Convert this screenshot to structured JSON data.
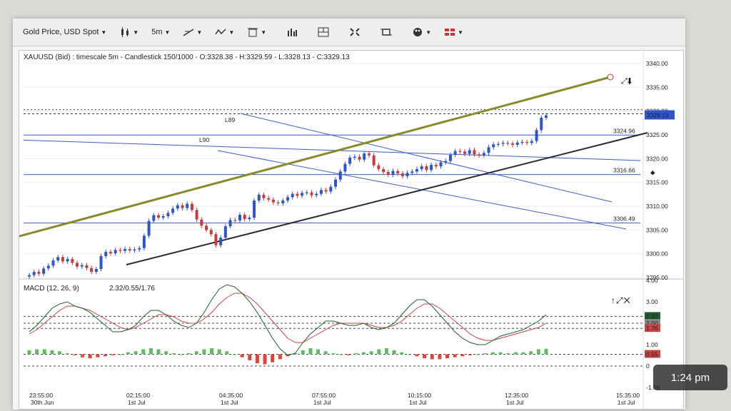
{
  "toolbar": {
    "instrument_label": "Gold Price, USD Spot",
    "timeframe_label": "5m",
    "icons": [
      "candlestick-type-icon",
      "line-tool-icon",
      "indicator-icon",
      "trash-icon",
      "bar-icon",
      "layout-icon",
      "fullscreen-icon",
      "crosshair-icon",
      "color-palette-icon",
      "flag-icon"
    ]
  },
  "chart_header": {
    "text": "XAUUSD (Bid) : timescale 5m - Candlestick",
    "stats": "150/1000 - O:3328.38 - H:3329.59 - L:3328.13 - C:3329.13"
  },
  "macd_header": {
    "name": "MACD (12, 26, 9)",
    "values": "2.32/0.55/1.76"
  },
  "status_time": "1:24 pm",
  "colors": {
    "up_candle": "#2e55c9",
    "down_candle": "#c63b3b",
    "channel_upper": "#8a8a2a",
    "channel_lower": "#2b2b2b",
    "hline": "#3a5fc8",
    "macd_line": "#1d5e2e",
    "signal_line": "#c54444",
    "hist_pos": "#5bbf5b",
    "hist_neg": "#d9483a"
  },
  "chart_data": {
    "type": "candlestick",
    "price_axis": {
      "min": 3295.0,
      "max": 3340.0,
      "ticks": [
        "3340.00",
        "3335.00",
        "3330.00",
        "3325.00",
        "3320.00",
        "3315.00",
        "3310.00",
        "3305.00",
        "3300.00",
        "3295.00"
      ]
    },
    "last_price": "3329.13",
    "hlines": [
      {
        "label": "3324.96",
        "value": 3324.96
      },
      {
        "label": "3316.66",
        "value": 3316.66
      },
      {
        "label": "3306.49",
        "value": 3306.49
      }
    ],
    "line_labels": [
      "L89",
      "L90"
    ],
    "time_labels": [
      {
        "time": "23:55:00",
        "date": "30th Jun"
      },
      {
        "time": "02:15:00",
        "date": "1st Jul"
      },
      {
        "time": "04:35:00",
        "date": "1st Jul"
      },
      {
        "time": "07:55:00",
        "date": "1st Jul"
      },
      {
        "time": "10:15:00",
        "date": "1st Jul"
      },
      {
        "time": "12:35:00",
        "date": "1st Jul"
      },
      {
        "time": "15:35:00",
        "date": "1st Jul"
      }
    ],
    "closes": [
      3295.5,
      3296.2,
      3295.8,
      3296.9,
      3297.5,
      3298.6,
      3299.3,
      3298.4,
      3298.9,
      3298.1,
      3297.3,
      3297.6,
      3297.0,
      3296.2,
      3296.8,
      3299.5,
      3300.4,
      3300.1,
      3300.8,
      3300.6,
      3301.0,
      3300.7,
      3300.9,
      3301.2,
      3303.8,
      3306.9,
      3308.1,
      3307.6,
      3307.9,
      3308.6,
      3309.5,
      3310.2,
      3309.6,
      3310.5,
      3309.2,
      3307.2,
      3305.9,
      3305.0,
      3304.1,
      3301.8,
      3303.4,
      3305.8,
      3307.1,
      3307.0,
      3308.2,
      3307.3,
      3307.6,
      3311.2,
      3312.4,
      3311.7,
      3311.4,
      3310.8,
      3310.6,
      3311.2,
      3311.9,
      3312.6,
      3312.2,
      3312.8,
      3312.9,
      3312.3,
      3312.6,
      3313.4,
      3313.1,
      3314.1,
      3315.6,
      3317.3,
      3318.9,
      3320.2,
      3320.4,
      3319.8,
      3321.1,
      3320.7,
      3318.6,
      3317.8,
      3317.2,
      3316.6,
      3317.4,
      3316.9,
      3316.3,
      3317.0,
      3317.3,
      3317.8,
      3318.4,
      3317.6,
      3318.7,
      3318.4,
      3319.2,
      3319.5,
      3320.8,
      3321.6,
      3321.5,
      3321.0,
      3321.8,
      3320.9,
      3320.7,
      3321.2,
      3322.4,
      3323.0,
      3323.1,
      3323.3,
      3323.2,
      3322.9,
      3323.4,
      3323.5,
      3323.3,
      3323.7,
      3326.0,
      3328.6,
      3329.1
    ],
    "macd": {
      "ylim": [
        -1.0,
        4.0
      ],
      "ticks": [
        "4.00",
        "3.00",
        "2.00",
        "1.00",
        "0",
        "-1.00"
      ],
      "values": {
        "macd": "2.32",
        "signal": "2.00",
        "diff": "1.76",
        "hist": "0.55"
      },
      "macd_line": [
        1.6,
        1.9,
        2.3,
        2.7,
        2.9,
        3.0,
        2.8,
        2.7,
        2.5,
        2.2,
        1.9,
        1.6,
        1.6,
        1.7,
        1.9,
        2.3,
        2.6,
        2.6,
        2.4,
        2.1,
        1.9,
        1.8,
        2.0,
        2.5,
        3.1,
        3.6,
        3.8,
        3.7,
        3.4,
        3.0,
        2.5,
        1.9,
        1.3,
        0.8,
        0.5,
        0.6,
        1.1,
        1.5,
        1.8,
        2.1,
        2.1,
        2.0,
        1.9,
        1.9,
        2.0,
        1.8,
        1.7,
        1.8,
        2.0,
        2.4,
        2.8,
        3.1,
        3.1,
        2.8,
        2.4,
        2.0,
        1.6,
        1.3,
        1.1,
        1.0,
        1.0,
        1.2,
        1.4,
        1.5,
        1.6,
        1.7,
        1.9,
        2.1,
        2.4
      ],
      "signal_line": [
        1.5,
        1.7,
        2.0,
        2.3,
        2.6,
        2.8,
        2.8,
        2.7,
        2.6,
        2.4,
        2.2,
        2.0,
        1.8,
        1.7,
        1.8,
        2.0,
        2.2,
        2.4,
        2.4,
        2.3,
        2.1,
        2.0,
        2.0,
        2.2,
        2.5,
        2.9,
        3.2,
        3.4,
        3.4,
        3.2,
        2.9,
        2.5,
        2.1,
        1.7,
        1.3,
        1.1,
        1.1,
        1.3,
        1.5,
        1.7,
        1.9,
        2.0,
        2.0,
        2.0,
        2.0,
        1.9,
        1.8,
        1.8,
        1.9,
        2.1,
        2.4,
        2.7,
        2.9,
        2.9,
        2.7,
        2.4,
        2.1,
        1.8,
        1.5,
        1.3,
        1.2,
        1.2,
        1.3,
        1.4,
        1.5,
        1.6,
        1.7,
        1.8,
        2.0
      ],
      "histogram": [
        0.4,
        0.5,
        0.5,
        0.4,
        0.3,
        0.1,
        -0.1,
        -0.3,
        -0.4,
        -0.3,
        -0.2,
        -0.1,
        0.0,
        0.2,
        0.3,
        0.5,
        0.6,
        0.5,
        0.3,
        0.1,
        0.0,
        0.1,
        0.3,
        0.5,
        0.6,
        0.5,
        0.3,
        0.0,
        -0.3,
        -0.6,
        -0.9,
        -1.0,
        -0.8,
        -0.5,
        -0.2,
        0.1,
        0.4,
        0.6,
        0.5,
        0.3,
        0.1,
        0.0,
        -0.1,
        0.1,
        0.2,
        0.3,
        0.5,
        0.6,
        0.4,
        0.2,
        0.0,
        -0.2,
        -0.4,
        -0.5,
        -0.5,
        -0.4,
        -0.3,
        -0.2,
        -0.1,
        0.0,
        0.1,
        0.2,
        0.2,
        0.1,
        0.2,
        0.2,
        0.3,
        0.5,
        0.55
      ]
    }
  }
}
